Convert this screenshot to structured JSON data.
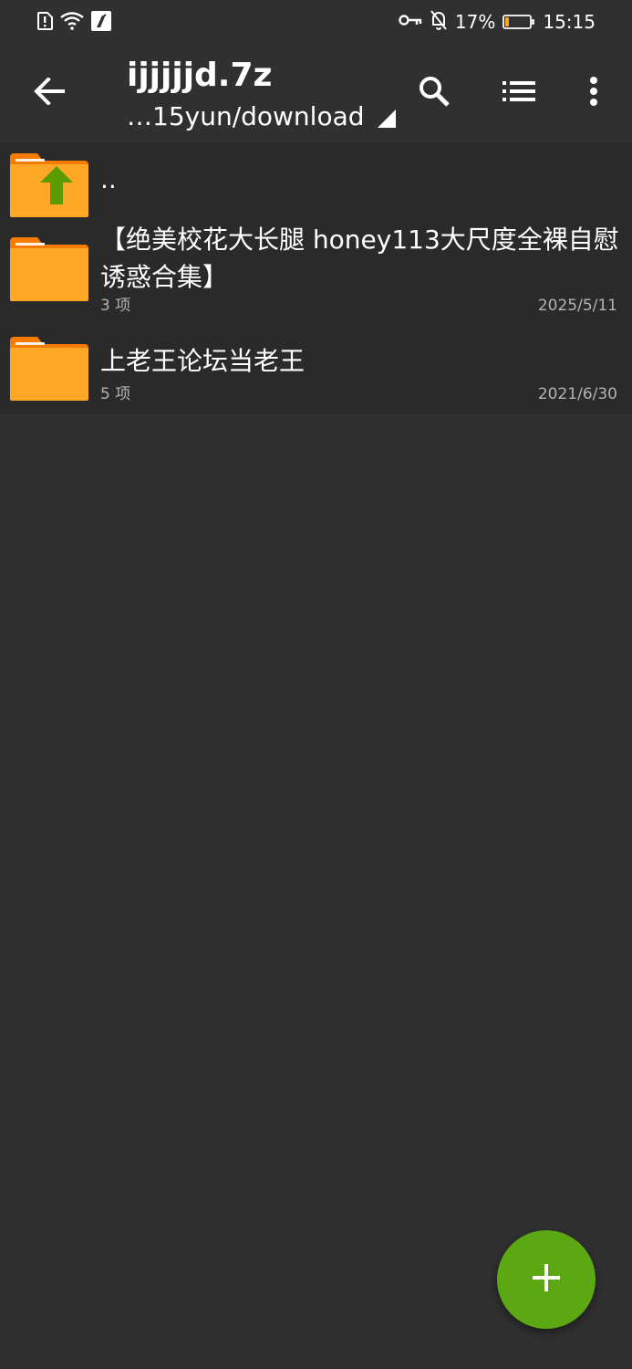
{
  "status_bar": {
    "battery_percent": "17%",
    "battery_level": 0.17,
    "time": "15:15",
    "icons": [
      "alert-icon",
      "wifi-icon",
      "app-notification-icon",
      "key-icon",
      "bell-off-icon",
      "battery-icon"
    ]
  },
  "toolbar": {
    "title": "ijjjjjd.7z",
    "path": "…15yun/download",
    "icons": [
      "back-arrow-icon",
      "search-icon",
      "list-view-icon",
      "more-vert-icon"
    ]
  },
  "files": {
    "parent": {
      "name": ".."
    },
    "items": [
      {
        "name": "【绝美校花大长腿 honey113大尺度全裸自慰诱惑合集】",
        "count": "3 项",
        "date": "2025/5/11"
      },
      {
        "name": "上老王论坛当老王",
        "count": "5 项",
        "date": "2021/6/30"
      }
    ]
  },
  "fab": {
    "icon": "plus-icon"
  },
  "colors": {
    "background": "#303030",
    "list_background": "#2a2a2a",
    "folder": "#ffa726",
    "folder_tab": "#f57c00",
    "up_arrow": "#5b9a00",
    "fab": "#5ba714",
    "battery_fill": "#f5a623"
  }
}
